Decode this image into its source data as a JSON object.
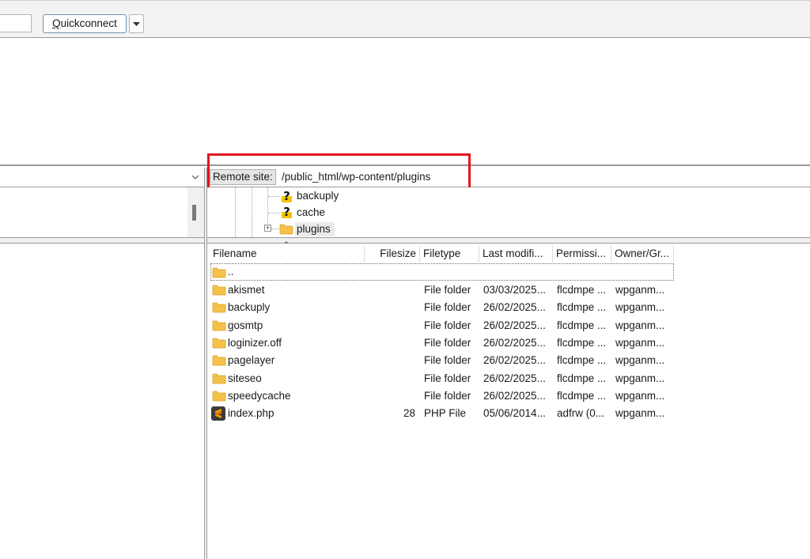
{
  "quickconnect": {
    "button_label_underlined": "Q",
    "button_label_rest": "uickconnect"
  },
  "remote_site": {
    "label": "Remote site:",
    "path": "/public_html/wp-content/plugins"
  },
  "remote_tree": {
    "items": [
      {
        "label": "backuply",
        "icon": "question-icon"
      },
      {
        "label": "cache",
        "icon": "question-icon"
      },
      {
        "label": "plugins",
        "icon": "folder-icon",
        "expandable": true,
        "selected": true
      }
    ]
  },
  "remote_list": {
    "columns": [
      "Filename",
      "Filesize",
      "Filetype",
      "Last modifi...",
      "Permissi...",
      "Owner/Gr..."
    ],
    "parent_label": "..",
    "rows": [
      {
        "name": "akismet",
        "size": "",
        "type": "File folder",
        "modified": "03/03/2025...",
        "perms": "flcdmpe ...",
        "owner": "wpganm...",
        "icon": "folder-icon"
      },
      {
        "name": "backuply",
        "size": "",
        "type": "File folder",
        "modified": "26/02/2025...",
        "perms": "flcdmpe ...",
        "owner": "wpganm...",
        "icon": "folder-icon"
      },
      {
        "name": "gosmtp",
        "size": "",
        "type": "File folder",
        "modified": "26/02/2025...",
        "perms": "flcdmpe ...",
        "owner": "wpganm...",
        "icon": "folder-icon"
      },
      {
        "name": "loginizer.off",
        "size": "",
        "type": "File folder",
        "modified": "26/02/2025...",
        "perms": "flcdmpe ...",
        "owner": "wpganm...",
        "icon": "folder-icon"
      },
      {
        "name": "pagelayer",
        "size": "",
        "type": "File folder",
        "modified": "26/02/2025...",
        "perms": "flcdmpe ...",
        "owner": "wpganm...",
        "icon": "folder-icon"
      },
      {
        "name": "siteseo",
        "size": "",
        "type": "File folder",
        "modified": "26/02/2025...",
        "perms": "flcdmpe ...",
        "owner": "wpganm...",
        "icon": "folder-icon"
      },
      {
        "name": "speedycache",
        "size": "",
        "type": "File folder",
        "modified": "26/02/2025...",
        "perms": "flcdmpe ...",
        "owner": "wpganm...",
        "icon": "folder-icon"
      },
      {
        "name": "index.php",
        "size": "28",
        "type": "PHP File",
        "modified": "05/06/2014...",
        "perms": "adfrw (0...",
        "owner": "wpganm...",
        "icon": "sublime-file-icon"
      }
    ]
  },
  "colors": {
    "highlight": "#e3161e",
    "folder": "#f4c24a",
    "question": "#f4c300"
  }
}
